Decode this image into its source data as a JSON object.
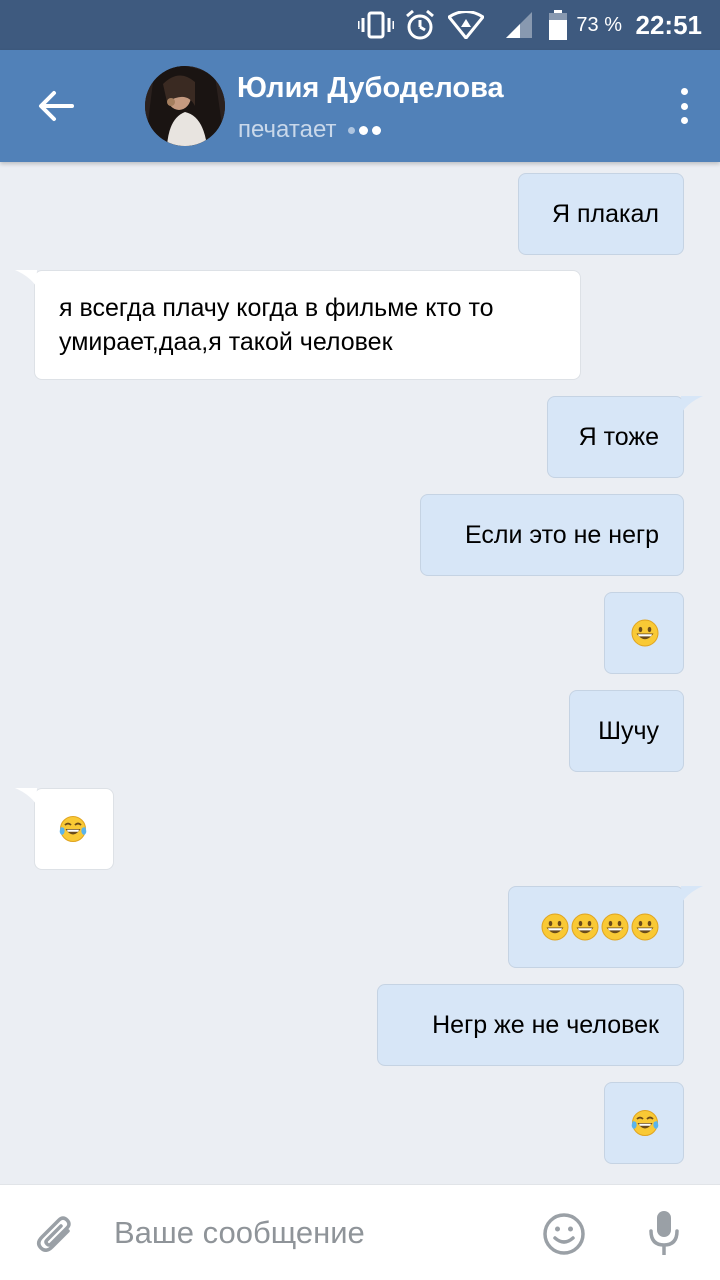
{
  "status_bar": {
    "battery_percent": "73 %",
    "time": "22:51",
    "icons": [
      "vibrate-icon",
      "alarm-icon",
      "wifi-icon",
      "signal-icon",
      "battery-icon"
    ]
  },
  "header": {
    "contact_name": "Юлия Дубоделова",
    "status": "печатает",
    "icons": [
      "back-arrow-icon",
      "more-vertical-icon"
    ]
  },
  "messages": [
    {
      "direction": "out",
      "text": "Я плакал"
    },
    {
      "direction": "in",
      "text": "я всегда плачу когда в фильме кто то умирает,даа,я такой человек"
    },
    {
      "direction": "out",
      "text": "Я тоже"
    },
    {
      "direction": "out",
      "text": "Если это не негр"
    },
    {
      "direction": "out",
      "emoji": [
        "grinning-face-icon"
      ]
    },
    {
      "direction": "out",
      "text": "Шучу"
    },
    {
      "direction": "in",
      "emoji": [
        "tears-of-joy-icon"
      ]
    },
    {
      "direction": "out",
      "emoji": [
        "grinning-face-icon",
        "grinning-face-icon",
        "grinning-face-icon",
        "grinning-face-icon"
      ]
    },
    {
      "direction": "out",
      "text": "Негр же не человек"
    },
    {
      "direction": "out",
      "emoji": [
        "tears-of-joy-icon"
      ]
    }
  ],
  "composer": {
    "placeholder": "Ваше сообщение",
    "icons": [
      "attach-icon",
      "emoji-icon",
      "microphone-icon"
    ]
  },
  "colors": {
    "header": "#5181b8",
    "status_bar": "#3e5a7f",
    "background": "#ebeef3",
    "outgoing_bubble": "#d7e6f7",
    "incoming_bubble": "#ffffff"
  }
}
